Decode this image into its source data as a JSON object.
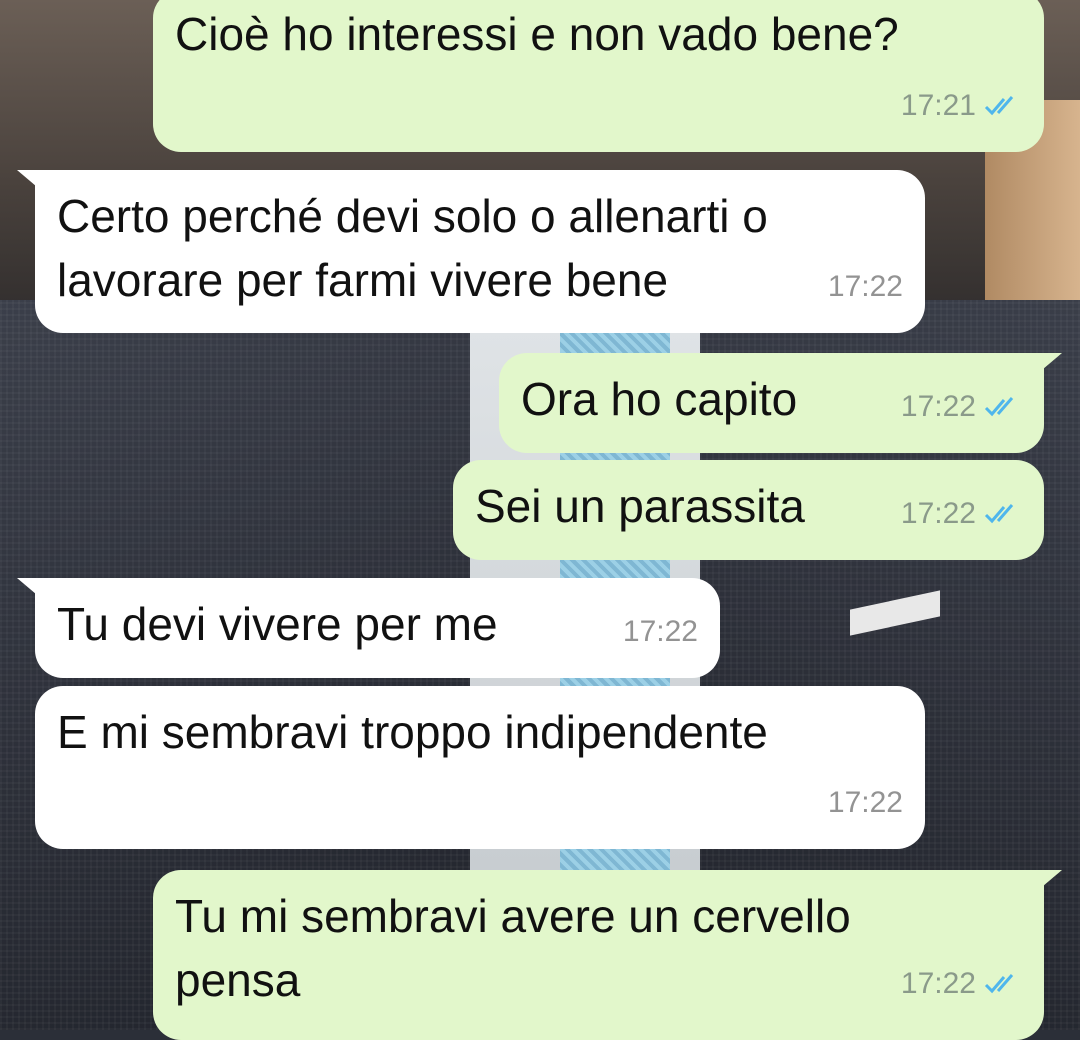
{
  "messages": [
    {
      "text": "Cioè ho interessi e non vado bene?",
      "time": "17:21",
      "direction": "outgoing",
      "read": true
    },
    {
      "text": "Certo perché devi solo o allenarti o\nlavorare per farmi vivere bene",
      "time": "17:22",
      "direction": "incoming"
    },
    {
      "text": "Ora ho capito",
      "time": "17:22",
      "direction": "outgoing",
      "read": true
    },
    {
      "text": "Sei un parassita",
      "time": "17:22",
      "direction": "outgoing",
      "read": true
    },
    {
      "text": "Tu devi vivere per me",
      "time": "17:22",
      "direction": "incoming"
    },
    {
      "text": "E mi sembravi troppo indipendente",
      "time": "17:22",
      "direction": "incoming"
    },
    {
      "text": "Tu mi sembravi avere un cervello\npensa",
      "time": "17:22",
      "direction": "outgoing",
      "read": true
    }
  ],
  "colors": {
    "outgoing_bubble": "#e2f7cb",
    "incoming_bubble": "#ffffff",
    "read_ticks": "#4fb6ec"
  },
  "icons": {
    "read_receipt": "double-check-icon"
  }
}
